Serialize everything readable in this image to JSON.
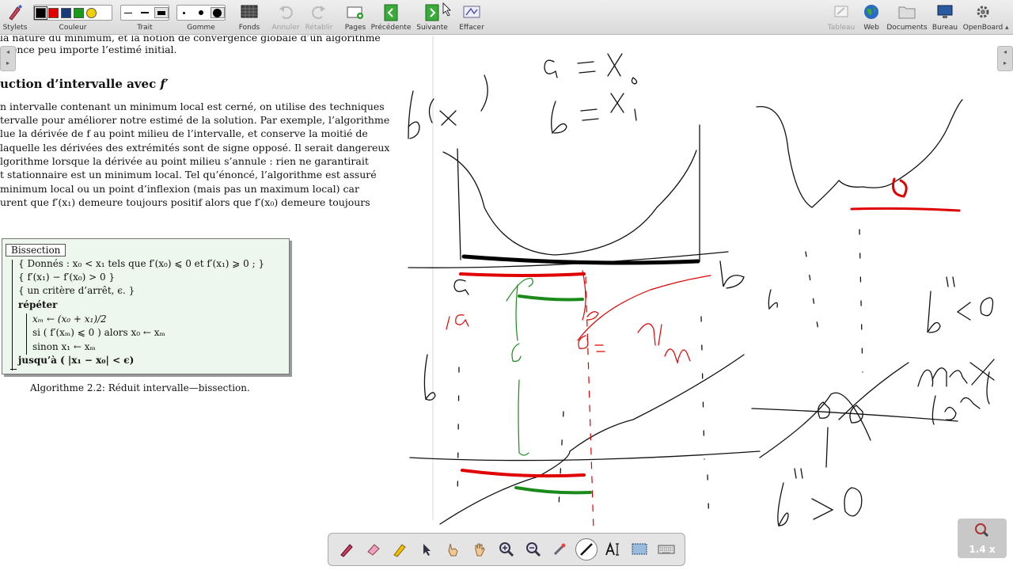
{
  "toolbar": {
    "left": {
      "stylets": "Stylets",
      "couleur": "Couleur",
      "trait": "Trait",
      "gomme": "Gomme",
      "fonds": "Fonds",
      "annuler": "Annuler",
      "retablir": "Rétablir",
      "pages": "Pages",
      "precedente": "Précédente",
      "suivante": "Suivante",
      "effacer": "Effacer"
    },
    "right": {
      "tableau": "Tableau",
      "web": "Web",
      "documents": "Documents",
      "bureau": "Bureau",
      "openboard": "OpenBoard"
    },
    "colors": [
      "#000000",
      "#e00000",
      "#1a3a7a",
      "#1a9a1a",
      "#f0d000"
    ],
    "selected_color": "#000000"
  },
  "document": {
    "line1": "la nature du minimum, et la notion de convergence globale d’un algorithme",
    "line2": "rgence peu importe l’estimé initial.",
    "heading_main": "uction d’intervalle avec ",
    "heading_var": "f′",
    "para": [
      "n intervalle contenant un minimum local est cerné, on utilise des techniques",
      "tervalle pour améliorer notre estimé de la solution. Par exemple, l’algorithme",
      "lue la dérivée de f au point milieu de l’intervalle, et conserve la moitié de",
      "laquelle les dérivées des extrémités sont de signe opposé. Il serait dangereux",
      "lgorithme lorsque la dérivée au point milieu s’annule : rien ne garantirait",
      "t stationnaire est un minimum local. Tel qu’énoncé, l’algorithme est assuré",
      " minimum local ou un point d’inflexion (mais pas un maximum local) car",
      "urent que f′(x₁) demeure toujours positif alors que f′(x₀) demeure toujours"
    ],
    "algorithm": {
      "title": "Bissection",
      "lines": [
        "{ Donnés : x₀ < x₁ tels que f′(x₀) ⩽ 0 et f′(x₁) ⩾ 0 ; }",
        "{                                  f′(x₁) − f′(x₀) > 0  }",
        "{    un critère d’arrêt, ϵ. }",
        "répéter",
        "xₘ  ←  (x₀ + x₁)/2",
        "si ( f′(xₘ) ⩽ 0 ) alors  x₀  ←  xₘ",
        "sinon   x₁  ←  xₘ",
        "jusqu’à ( |x₁ − x₀| < ϵ)"
      ]
    },
    "caption": "Algorithme 2.2: Réduit intervalle—bissection."
  },
  "zoom_level": "1.4 x"
}
